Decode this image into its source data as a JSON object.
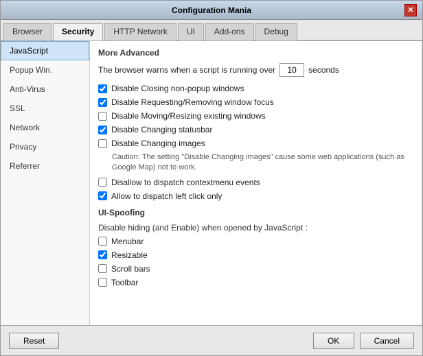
{
  "window": {
    "title": "Configuration Mania"
  },
  "tabs": [
    {
      "id": "browser",
      "label": "Browser",
      "active": false
    },
    {
      "id": "security",
      "label": "Security",
      "active": true
    },
    {
      "id": "http-network",
      "label": "HTTP Network",
      "active": false
    },
    {
      "id": "ui",
      "label": "UI",
      "active": false
    },
    {
      "id": "add-ons",
      "label": "Add-ons",
      "active": false
    },
    {
      "id": "debug",
      "label": "Debug",
      "active": false
    }
  ],
  "sidebar": {
    "items": [
      {
        "id": "javascript",
        "label": "JavaScript",
        "active": true
      },
      {
        "id": "popup-win",
        "label": "Popup Win.",
        "active": false
      },
      {
        "id": "anti-virus",
        "label": "Anti-Virus",
        "active": false
      },
      {
        "id": "ssl",
        "label": "SSL",
        "active": false
      },
      {
        "id": "network",
        "label": "Network",
        "active": false
      },
      {
        "id": "privacy",
        "label": "Privacy",
        "active": false
      },
      {
        "id": "referrer",
        "label": "Referrer",
        "active": false
      }
    ]
  },
  "main": {
    "section_title": "More Advanced",
    "script_timeout_label": "The browser warns when a script is running over",
    "script_timeout_value": "10",
    "script_timeout_unit": "seconds",
    "checkboxes": [
      {
        "id": "cb1",
        "checked": true,
        "label": "Disable Closing non-popup windows"
      },
      {
        "id": "cb2",
        "checked": true,
        "label": "Disable Requesting/Removing window focus"
      },
      {
        "id": "cb3",
        "checked": false,
        "label": "Disable Moving/Resizing existing windows"
      },
      {
        "id": "cb4",
        "checked": true,
        "label": "Disable Changing statusbar"
      },
      {
        "id": "cb5",
        "checked": false,
        "label": "Disable Changing images"
      }
    ],
    "caution_text": "Caution: The setting \"Disable Changing images\" cause some web applications (such as Google Map) not to work.",
    "checkboxes2": [
      {
        "id": "cb6",
        "checked": false,
        "label": "Disallow to dispatch contextmenu events"
      },
      {
        "id": "cb7",
        "checked": true,
        "label": "Allow to dispatch left click only"
      }
    ],
    "ui_spoofing_title": "UI-Spoofing",
    "ui_spoofing_sub": "Disable hiding (and Enable) when opened by JavaScript :",
    "checkboxes3": [
      {
        "id": "cb8",
        "checked": false,
        "label": "Menubar"
      },
      {
        "id": "cb9",
        "checked": true,
        "label": "Resizable"
      },
      {
        "id": "cb10",
        "checked": false,
        "label": "Scroll bars"
      },
      {
        "id": "cb11",
        "checked": false,
        "label": "Toolbar"
      }
    ]
  },
  "buttons": {
    "reset": "Reset",
    "ok": "OK",
    "cancel": "Cancel"
  }
}
